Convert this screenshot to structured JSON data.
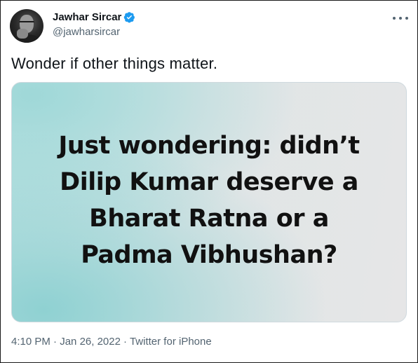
{
  "author": {
    "display_name": "Jawhar Sircar",
    "handle": "@jawharsircar",
    "verified": true,
    "verified_color": "#1d9bf0"
  },
  "tweet": {
    "text": "Wonder if other things matter."
  },
  "media": {
    "lines": [
      "Just wondering: didn’t",
      "Dilip Kumar deserve a",
      "Bharat Ratna or a",
      "Padma Vibhushan?"
    ]
  },
  "meta": {
    "time": "4:10 PM",
    "date": "Jan 26, 2022",
    "source": "Twitter for iPhone",
    "separator": "·"
  },
  "icons": {
    "more": "more-horizontal-icon",
    "verified": "verified-badge-icon"
  }
}
